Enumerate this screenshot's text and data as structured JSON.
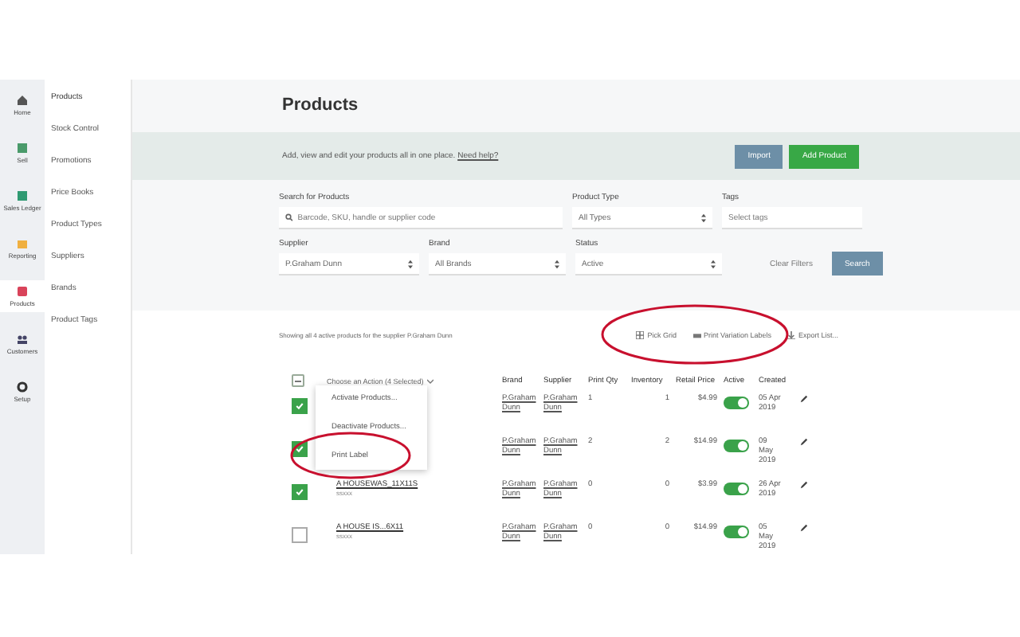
{
  "rail": [
    {
      "label": "Home",
      "selected": false
    },
    {
      "label": "Sell",
      "selected": false
    },
    {
      "label": "Sales Ledger",
      "selected": false
    },
    {
      "label": "Reporting",
      "selected": false
    },
    {
      "label": "Products",
      "selected": true
    },
    {
      "label": "Customers",
      "selected": false
    },
    {
      "label": "Setup",
      "selected": false
    }
  ],
  "nav": [
    {
      "label": "Products",
      "selected": true
    },
    {
      "label": "Stock Control",
      "selected": false
    },
    {
      "label": "Promotions",
      "selected": false
    },
    {
      "label": "Price Books",
      "selected": false
    },
    {
      "label": "Product Types",
      "selected": false
    },
    {
      "label": "Suppliers",
      "selected": false
    },
    {
      "label": "Brands",
      "selected": false
    },
    {
      "label": "Product Tags",
      "selected": false
    }
  ],
  "title": "Products",
  "banner": {
    "text": "Add, view and edit your products all in one place.",
    "link": "Need help?",
    "buttons": [
      {
        "label": "Import",
        "kind": "secondary"
      },
      {
        "label": "Add Product",
        "kind": "primary"
      }
    ]
  },
  "filters": {
    "search": {
      "label": "Search for Products",
      "placeholder": "Barcode, SKU, handle or supplier code"
    },
    "product_type": {
      "label": "Product Type",
      "value": "All Types"
    },
    "tags": {
      "label": "Tags",
      "placeholder": "Select tags"
    },
    "supplier": {
      "label": "Supplier",
      "value": "P.Graham Dunn"
    },
    "brand": {
      "label": "Brand",
      "value": "All Brands"
    },
    "status": {
      "label": "Status",
      "value": "Active"
    },
    "clear": "Clear Filters",
    "search_button": "Search"
  },
  "summary": "Showing all 4 active products for the supplier P.Graham Dunn",
  "toolbar": [
    {
      "label": "Pick Grid"
    },
    {
      "label": "Print Variation Labels"
    },
    {
      "label": "Export List..."
    }
  ],
  "table": {
    "select_all_partial": true,
    "action": "Choose an Action (4 Selected)",
    "columns": [
      "Brand",
      "Supplier",
      "Print Qty",
      "Inventory",
      "Retail Price",
      "Active",
      "Created"
    ],
    "rows": [
      {
        "checked": true,
        "brand": "P.Graham Dunn",
        "supplier": "P.Graham Dunn",
        "qty": "1",
        "inventory": "1",
        "price": "$4.99",
        "active": true,
        "created": "05 Apr 2019"
      },
      {
        "checked": true,
        "brand": "P.Graham Dunn",
        "supplier": "P.Graham Dunn",
        "qty": "2",
        "inventory": "2",
        "price": "$14.99",
        "active": true,
        "created": "09 May 2019"
      },
      {
        "checked": true,
        "name": "A HOUSEWAS_11X11S",
        "sku": "ssxxx",
        "brand": "P.Graham Dunn",
        "supplier": "P.Graham Dunn",
        "qty": "0",
        "inventory": "0",
        "price": "$3.99",
        "active": true,
        "created": "26 Apr 2019"
      },
      {
        "checked": false,
        "name": "A HOUSE IS...6X11",
        "sku": "ssxxx",
        "brand": "P.Graham Dunn",
        "supplier": "P.Graham Dunn",
        "qty": "0",
        "inventory": "0",
        "price": "$14.99",
        "active": true,
        "created": "05 May 2019"
      }
    ]
  },
  "action_menu": [
    "Activate Products...",
    "Deactivate Products...",
    "Print Label"
  ]
}
